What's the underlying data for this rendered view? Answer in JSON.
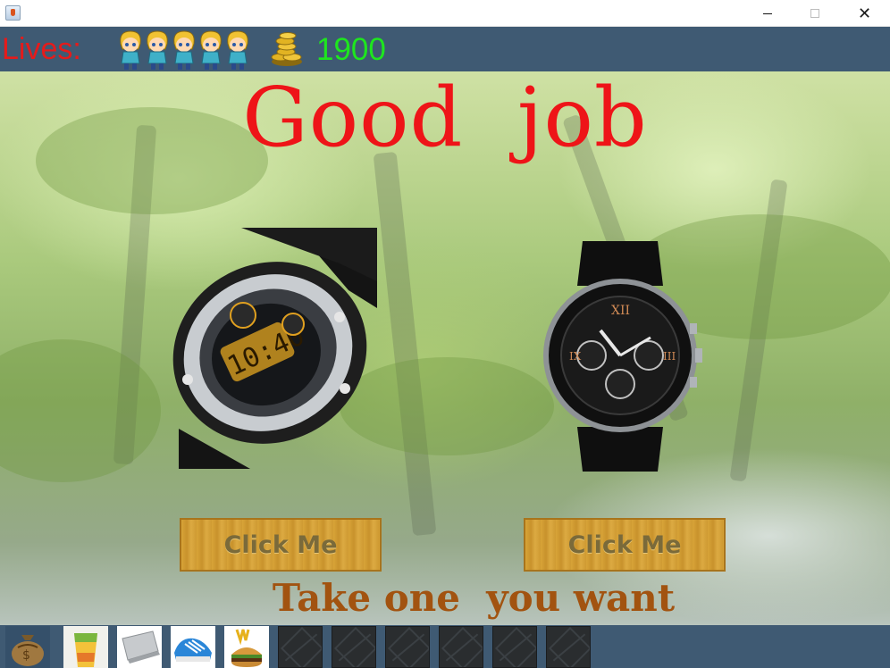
{
  "window": {
    "close_glyph": "✕"
  },
  "hud": {
    "lives_label": "Lives:",
    "lives_count": 5,
    "life_icon": "hero-girl-icon",
    "coins_icon": "gold-coins-icon",
    "score": "1900",
    "colors": {
      "lives_label": "#e51b1b",
      "score": "#1ee61e",
      "bar": "#3f5a73"
    }
  },
  "scene": {
    "title": "Good  job",
    "subtitle": "Take one  you want",
    "left_item": {
      "icon": "digital-sport-watch-icon",
      "button_label": "Click Me"
    },
    "right_item": {
      "icon": "chronograph-watch-icon",
      "button_label": "Click Me"
    },
    "colors": {
      "title": "#ee1418",
      "subtitle": "#a25310"
    }
  },
  "inventory": {
    "slots": [
      {
        "icon": "money-bag-icon",
        "filled": true
      },
      {
        "icon": "drink-cup-icon",
        "filled": true
      },
      {
        "icon": "laptop-icon",
        "filled": true
      },
      {
        "icon": "sneaker-icon",
        "filled": true
      },
      {
        "icon": "burger-icon",
        "filled": true
      },
      {
        "icon": "empty-slot-icon",
        "filled": false
      },
      {
        "icon": "empty-slot-icon",
        "filled": false
      },
      {
        "icon": "empty-slot-icon",
        "filled": false
      },
      {
        "icon": "empty-slot-icon",
        "filled": false
      },
      {
        "icon": "empty-slot-icon",
        "filled": false
      },
      {
        "icon": "empty-slot-icon",
        "filled": false
      }
    ]
  }
}
